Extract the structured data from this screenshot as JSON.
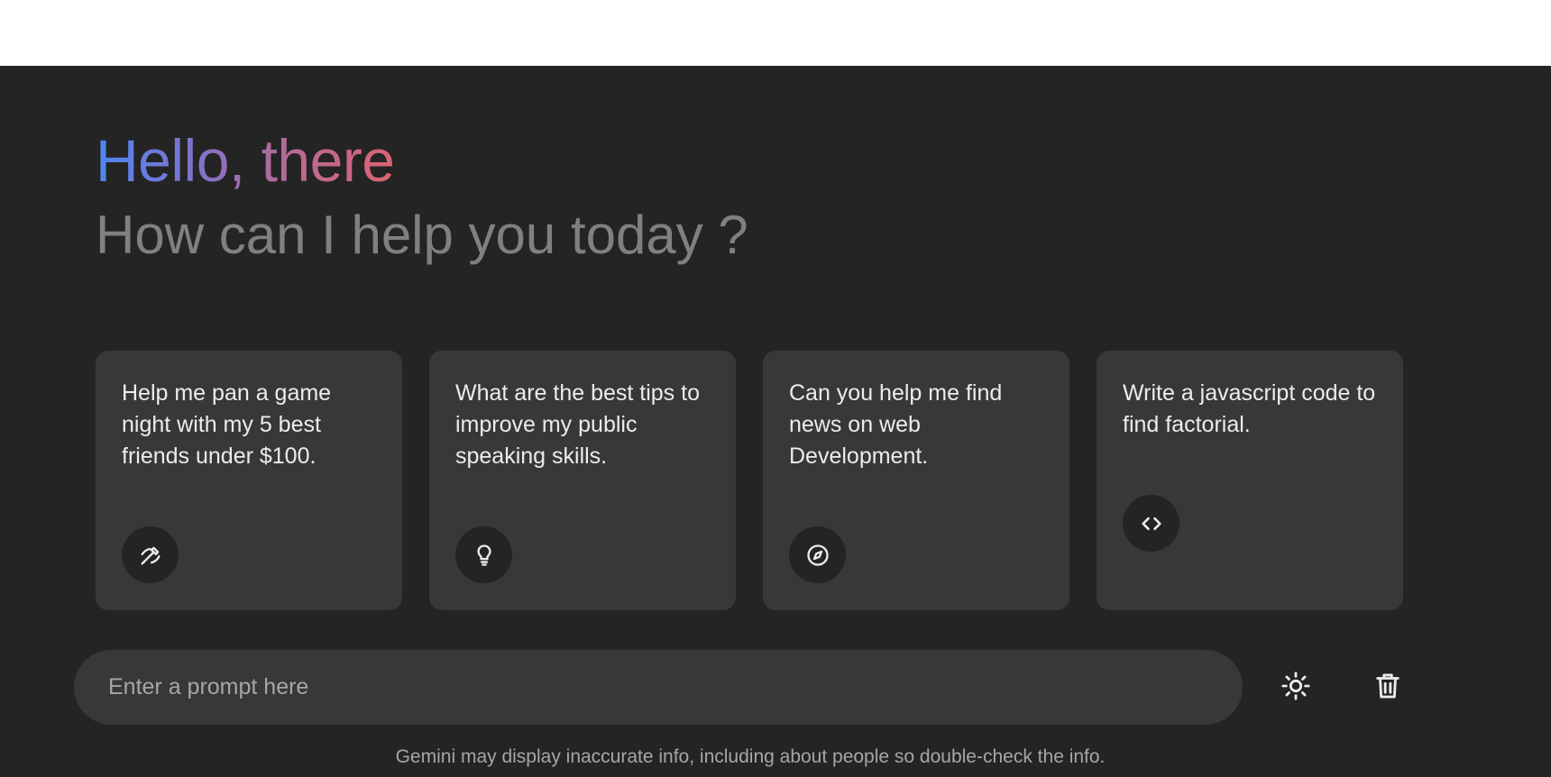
{
  "header": {
    "greeting": "Hello, there",
    "subtitle": "How can I help you today ?"
  },
  "suggestions": [
    {
      "text": "Help me pan a game night with my 5 best friends under $100.",
      "icon": "draw-icon"
    },
    {
      "text": "What are the best tips to improve my public speaking skills.",
      "icon": "lightbulb-icon"
    },
    {
      "text": "Can you help me find news on web Development.",
      "icon": "compass-icon"
    },
    {
      "text": "Write a javascript code to find factorial.",
      "icon": "code-icon"
    }
  ],
  "prompt": {
    "placeholder": "Enter a prompt here",
    "value": ""
  },
  "actions": {
    "theme_toggle_icon": "sun-icon",
    "delete_chats_icon": "trash-icon"
  },
  "footer": {
    "disclaimer": "Gemini may display inaccurate info, including about people so double-check the info."
  },
  "colors": {
    "background": "#242424",
    "card": "#383838",
    "greeting_gradient_start": "#4f86f0",
    "greeting_gradient_end": "#dc6372",
    "subtitle": "#808080"
  }
}
